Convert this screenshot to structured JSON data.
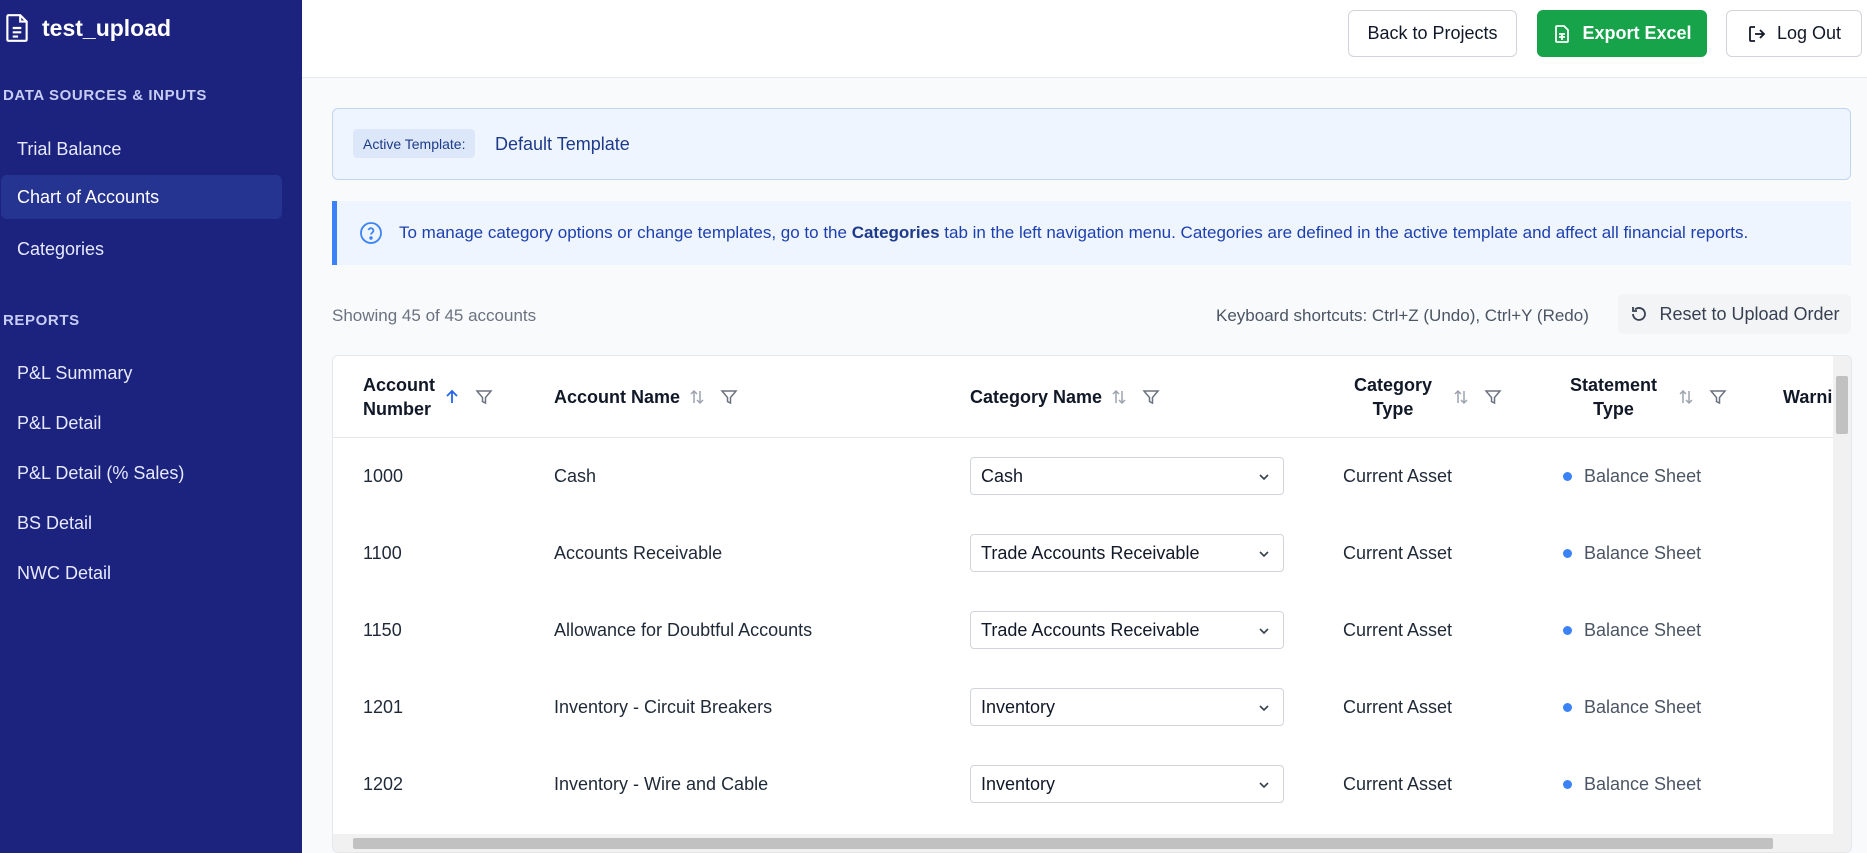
{
  "app": {
    "title": "test_upload"
  },
  "sidebar": {
    "sections": [
      {
        "label": "DATA SOURCES & INPUTS",
        "items": [
          "Trial Balance",
          "Chart of Accounts",
          "Categories"
        ]
      },
      {
        "label": "REPORTS",
        "items": [
          "P&L Summary",
          "P&L Detail",
          "P&L Detail (% Sales)",
          "BS Detail",
          "NWC Detail"
        ]
      }
    ],
    "active_item": "Chart of Accounts"
  },
  "header": {
    "back_label": "Back to Projects",
    "export_label": "Export Excel",
    "logout_label": "Log Out"
  },
  "template": {
    "badge": "Active Template:",
    "name": "Default Template"
  },
  "info": {
    "before": "To manage category options or change templates, go to the ",
    "link": "Categories",
    "after": " tab in the left navigation menu. Categories are defined in the active template and affect all financial reports."
  },
  "toolbar": {
    "showing": "Showing 45 of 45 accounts",
    "shortcuts": "Keyboard shortcuts: Ctrl+Z (Undo), Ctrl+Y (Redo)",
    "reset_label": "Reset to Upload Order"
  },
  "table": {
    "columns": {
      "account_number": [
        "Account",
        "Number"
      ],
      "account_name": "Account Name",
      "category_name": "Category Name",
      "category_type": [
        "Category",
        "Type"
      ],
      "statement_type": [
        "Statement",
        "Type"
      ],
      "warnings": "Warni"
    },
    "rows": [
      {
        "number": "1000",
        "name": "Cash",
        "category": "Cash",
        "type": "Current Asset",
        "statement": "Balance Sheet"
      },
      {
        "number": "1100",
        "name": "Accounts Receivable",
        "category": "Trade Accounts Receivable",
        "type": "Current Asset",
        "statement": "Balance Sheet"
      },
      {
        "number": "1150",
        "name": "Allowance for Doubtful Accounts",
        "category": "Trade Accounts Receivable",
        "type": "Current Asset",
        "statement": "Balance Sheet"
      },
      {
        "number": "1201",
        "name": "Inventory - Circuit Breakers",
        "category": "Inventory",
        "type": "Current Asset",
        "statement": "Balance Sheet"
      },
      {
        "number": "1202",
        "name": "Inventory - Wire and Cable",
        "category": "Inventory",
        "type": "Current Asset",
        "statement": "Balance Sheet"
      }
    ]
  },
  "colors": {
    "sidebar_bg": "#1c237e",
    "active_nav": "#263491",
    "green": "#16a34a",
    "accent_blue": "#3b82f6"
  }
}
